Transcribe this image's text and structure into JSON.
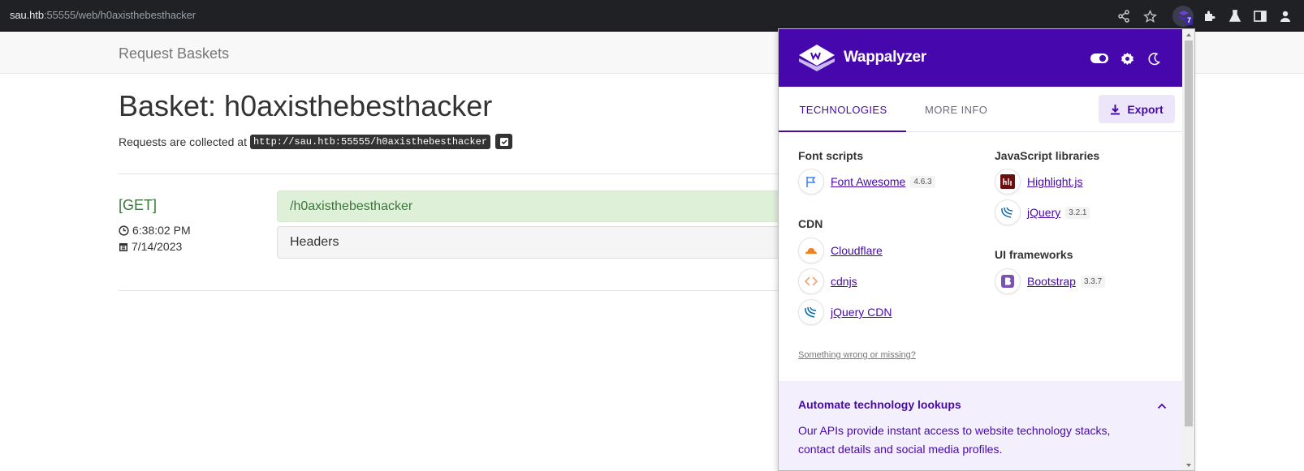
{
  "browser": {
    "url_host": "sau.htb",
    "url_rest": ":55555/web/h0axisthebesthacker",
    "extension_badge": "7",
    "icons": [
      "share-icon",
      "star-icon",
      "wappalyzer-extension-icon",
      "puzzle-icon",
      "flask-icon",
      "sidebar-icon",
      "profile-icon"
    ]
  },
  "page": {
    "brand": "Request Baskets",
    "title": "Basket: h0axisthebesthacker",
    "collect_prefix": "Requests are collected at",
    "collect_url": "http://sau.htb:55555/h0axisthebesthacker",
    "request": {
      "method": "[GET]",
      "time": "6:38:02 PM",
      "date": "7/14/2023",
      "path": "/h0axisthebesthacker",
      "headers_label": "Headers"
    }
  },
  "wappalyzer": {
    "name": "Wappalyzer",
    "tabs": {
      "technologies": "TECHNOLOGIES",
      "more_info": "MORE INFO"
    },
    "export_label": "Export",
    "categories": {
      "font_scripts": {
        "label": "Font scripts",
        "items": [
          {
            "name": "Font Awesome",
            "version": "4.6.3"
          }
        ]
      },
      "cdn": {
        "label": "CDN",
        "items": [
          {
            "name": "Cloudflare"
          },
          {
            "name": "cdnjs"
          },
          {
            "name": "jQuery CDN"
          }
        ]
      },
      "js_libraries": {
        "label": "JavaScript libraries",
        "items": [
          {
            "name": "Highlight.js"
          },
          {
            "name": "jQuery",
            "version": "3.2.1"
          }
        ]
      },
      "ui_frameworks": {
        "label": "UI frameworks",
        "items": [
          {
            "name": "Bootstrap",
            "version": "3.3.7"
          }
        ]
      }
    },
    "feedback": "Something wrong or missing?",
    "promo": {
      "title": "Automate technology lookups",
      "text": "Our APIs provide instant access to website technology stacks, contact details and social media profiles."
    },
    "accent_color": "#4608ad"
  }
}
